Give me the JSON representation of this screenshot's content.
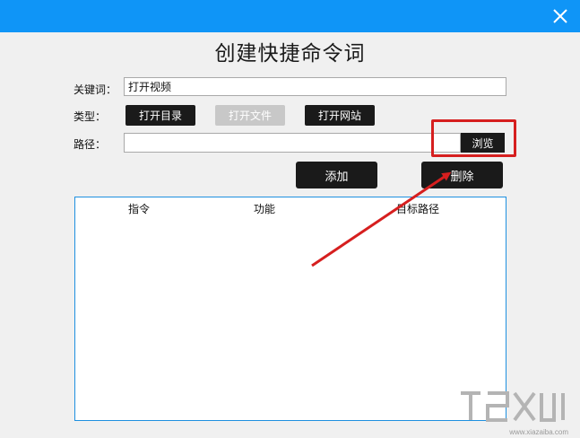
{
  "titlebar": {
    "close_icon": "close-icon",
    "color": "#0f95f7"
  },
  "dialog": {
    "title": "创建快捷命令词"
  },
  "form": {
    "keyword_label": "关键词：",
    "keyword_value": "打开视频",
    "type_label": "类型：",
    "type_buttons": [
      "打开目录",
      "打开文件",
      "打开网站"
    ],
    "path_label": "路径：",
    "path_value": "",
    "browse_label": "浏览"
  },
  "actions": {
    "add_label": "添加",
    "delete_label": "删除"
  },
  "table": {
    "columns": [
      "指令",
      "功能",
      "目标路径"
    ],
    "rows": []
  },
  "annotation": {
    "highlight_color": "#d61f1f",
    "arrow_color": "#d61f1f"
  },
  "watermark": {
    "text": "www.xiazaiba.com"
  }
}
